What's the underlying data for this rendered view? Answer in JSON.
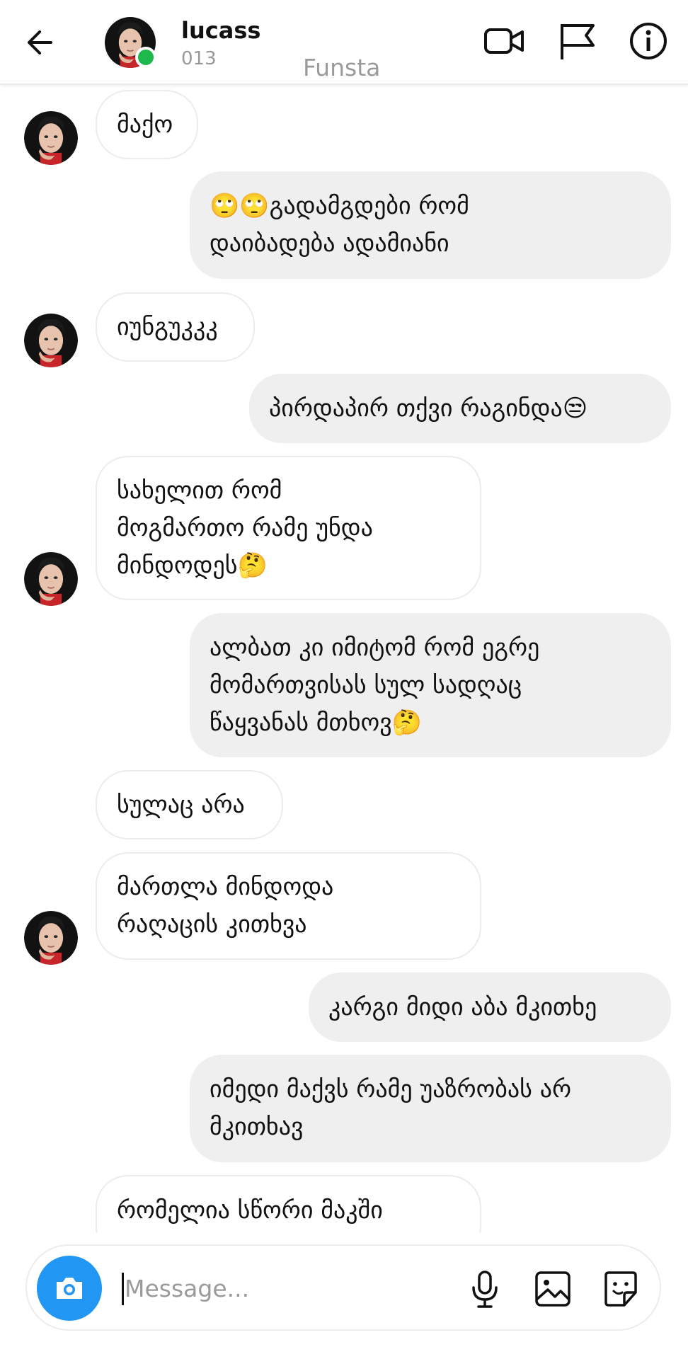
{
  "header": {
    "username": "lucass",
    "subtitle": "013",
    "watermark": "Funsta",
    "icons": [
      "back-arrow-icon",
      "video-call-icon",
      "flag-icon",
      "info-icon"
    ]
  },
  "messages": [
    {
      "side": "in",
      "text": "მაქო"
    },
    {
      "side": "out",
      "text": "🙄🙄გადამგდები რომ\nდაიბადება ადამიანი"
    },
    {
      "side": "in",
      "text": "იუნგუკკკ"
    },
    {
      "side": "out",
      "text": "პირდაპირ თქვი რაგინდა😒"
    },
    {
      "side": "in",
      "text": "სახელით რომ\nმოგმართო რამე უნდა\nმინდოდეს🤔"
    },
    {
      "side": "out",
      "text": "ალბათ კი იმიტომ რომ ეგრე\nმომართვისას სულ სადღაც\nწაყვანას მთხოვ🤔"
    },
    {
      "side": "in",
      "text": "სულაც არა"
    },
    {
      "side": "in",
      "text": "მართლა მინდოდა\nრაღაცის კითხვა"
    },
    {
      "side": "out",
      "text": "კარგი მიდი აბა მკითხე"
    },
    {
      "side": "out",
      "text": "იმედი მაქვს რამე უაზრობას არ\nმკითხავ"
    },
    {
      "side": "in",
      "text": "რომელია სწორი მაკში"
    }
  ],
  "composer": {
    "placeholder": "Message...",
    "value": "",
    "icons": [
      "camera-icon",
      "microphone-icon",
      "gallery-icon",
      "sticker-icon"
    ]
  },
  "colors": {
    "online": "#1fb84c",
    "camera_button": "#2196f3",
    "outgoing_bubble": "#efefef",
    "incoming_border": "#ececec"
  }
}
